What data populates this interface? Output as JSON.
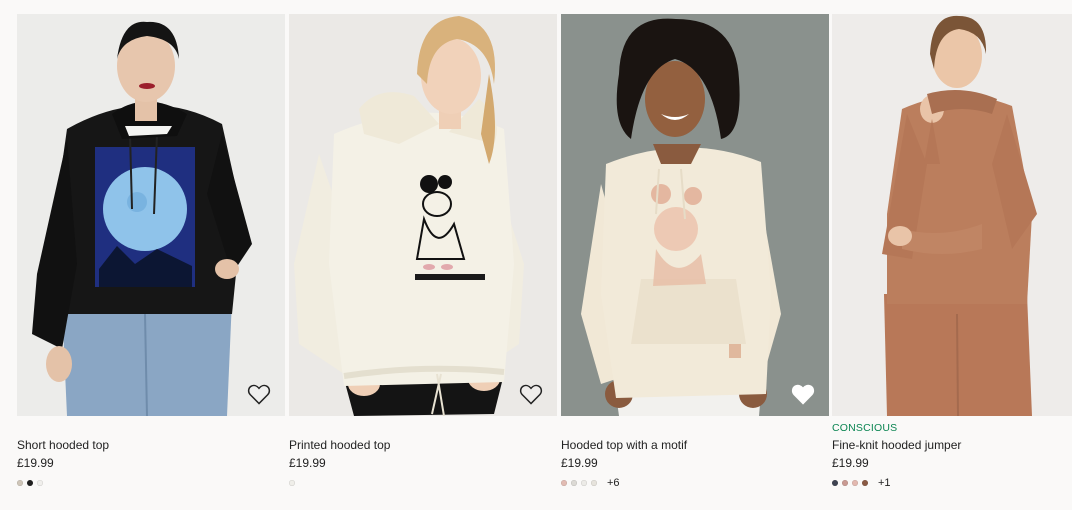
{
  "products": [
    {
      "tag": "",
      "name": "Short hooded top",
      "price": "£19.99",
      "colors": [
        "#cfc6b9",
        "#1f1f1f",
        "#f0efec"
      ],
      "more": "",
      "favorite_icon": "heart-outline-icon"
    },
    {
      "tag": "",
      "name": "Printed hooded top",
      "price": "£19.99",
      "colors": [
        "#efeee9"
      ],
      "more": "",
      "favorite_icon": "heart-outline-icon"
    },
    {
      "tag": "",
      "name": "Hooded top with a motif",
      "price": "£19.99",
      "colors": [
        "#e2bcb3",
        "#dcdad5",
        "#ecebe7",
        "#e6e3dc"
      ],
      "more": "+6",
      "favorite_icon": "heart-outline-icon"
    },
    {
      "tag": "CONSCIOUS",
      "name": "Fine-knit hooded jumper",
      "price": "£19.99",
      "colors": [
        "#3e4351",
        "#c99a92",
        "#e3b9b0",
        "#8a5a44"
      ],
      "more": "+1",
      "favorite_icon": "heart-outline-icon"
    }
  ],
  "theme": {
    "conscious_color": "#0b8552"
  }
}
